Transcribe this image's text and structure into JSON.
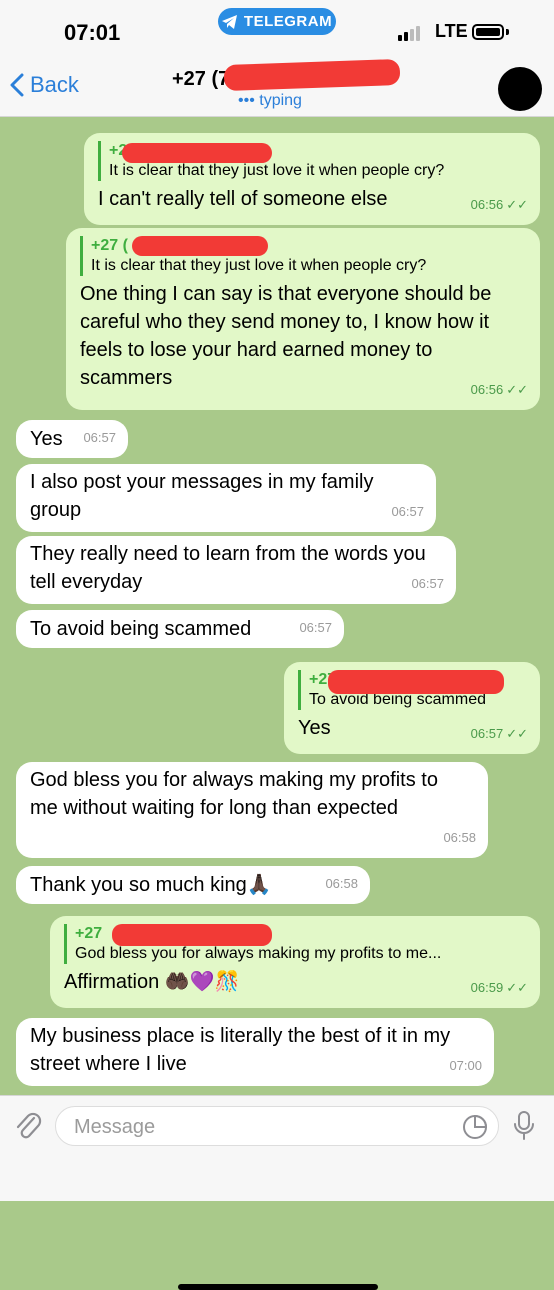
{
  "status_bar": {
    "time": "07:01",
    "app_pill": "TELEGRAM",
    "network": "LTE"
  },
  "header": {
    "back_label": "Back",
    "title": "+27 (7",
    "status": "••• typing"
  },
  "messages": [
    {
      "reply_name": "+27 (7",
      "reply_text": "It is clear that they just love it when people cry?",
      "text": "I can't really tell of someone else",
      "time": "06:56",
      "ticks": "✓✓"
    },
    {
      "reply_name": "+27 (",
      "reply_text": "It is clear that they just love it when people cry?",
      "text": "One thing I can say is that everyone should be careful who they send money to, I know how it feels to lose your hard earned money to scammers",
      "time": "06:56",
      "ticks": "✓✓"
    },
    {
      "text": "Yes",
      "time": "06:57"
    },
    {
      "text": "I also post your messages in my family group",
      "time": "06:57"
    },
    {
      "text": "They really need to learn from the words you tell everyday",
      "time": "06:57"
    },
    {
      "text": "To avoid being scammed",
      "time": "06:57"
    },
    {
      "reply_name": "+27",
      "reply_text": "To avoid being scammed",
      "text": "Yes",
      "time": "06:57",
      "ticks": "✓✓"
    },
    {
      "text": "God bless you for always making my profits to me without waiting for long than expected",
      "time": "06:58"
    },
    {
      "text": "Thank you so much king🙏🏿",
      "time": "06:58"
    },
    {
      "reply_name": "+27",
      "reply_text": "God bless you for always making my profits to me...",
      "text": "Affirmation 🤲🏿💜🎊",
      "time": "06:59",
      "ticks": "✓✓"
    },
    {
      "text": "My business place is literally the best of it in my street where I live",
      "time": "07:00"
    }
  ],
  "input": {
    "placeholder": "Message"
  },
  "colors": {
    "accent": "#2b7fd9",
    "outgoing_bubble": "#e2f8c8",
    "incoming_bubble": "#ffffff",
    "reply_bar": "#3fae3f",
    "redaction": "#f23a36"
  }
}
